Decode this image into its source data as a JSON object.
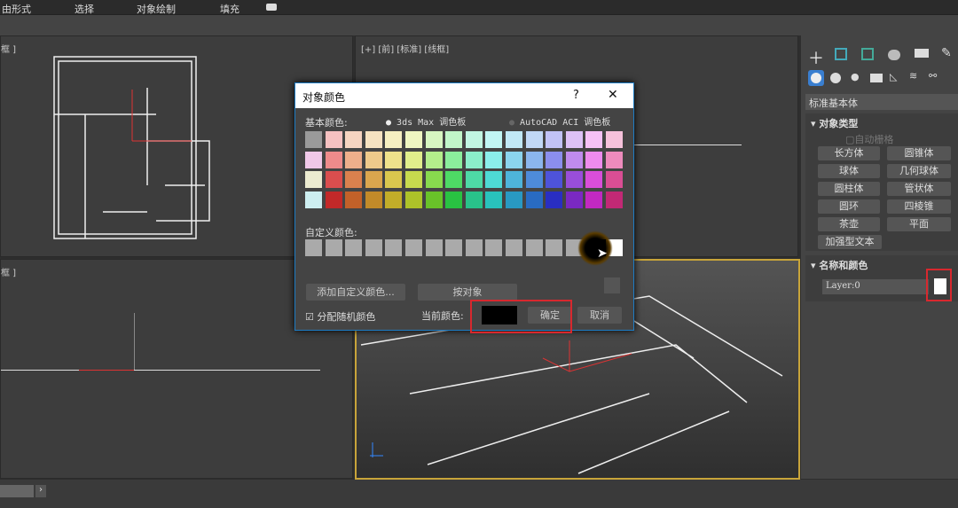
{
  "menu": [
    "由形式",
    "选择",
    "对象绘制",
    "填充"
  ],
  "viewports": {
    "top_left": "框 ]",
    "top_right": "[+] [前] [标准] [线框]",
    "bottom_left": "框 ]"
  },
  "panel": {
    "dropdown": "标准基本体",
    "object_type": {
      "title": "对象类型",
      "autogrid": "自动栅格",
      "buttons": [
        "长方体",
        "圆锥体",
        "球体",
        "几何球体",
        "圆柱体",
        "管状体",
        "圆环",
        "四棱锥",
        "茶壶",
        "平面",
        "加强型文本"
      ]
    },
    "name_color": {
      "title": "名称和颜色",
      "name_value": "Layer:0",
      "swatch_color": "#ffffff"
    }
  },
  "dialog": {
    "title": "对象颜色",
    "help": "?",
    "close": "✕",
    "basic_label": "基本颜色:",
    "radio_3ds": "3ds Max 调色板",
    "radio_aci": "AutoCAD ACI 调色板",
    "selected_palette": "3ds Max 调色板",
    "palette": {
      "first_column": [
        "#9a9a9a",
        "#f0c8e8",
        "#ecebd0",
        "#cdeef0"
      ],
      "hues": [
        0,
        22,
        38,
        52,
        68,
        95,
        130,
        158,
        178,
        196,
        214,
        238,
        272,
        300,
        330
      ],
      "row_lightness": [
        86,
        74,
        58,
        46
      ]
    },
    "custom_label": "自定义颜色:",
    "custom_selected_color": "#000000",
    "add_custom": "添加自定义颜色...",
    "by_object": "按对象",
    "random_checkbox": "分配随机颜色",
    "random_checked": true,
    "current_label": "当前颜色:",
    "current_color": "#000000",
    "ok": "确定",
    "cancel": "取消"
  }
}
